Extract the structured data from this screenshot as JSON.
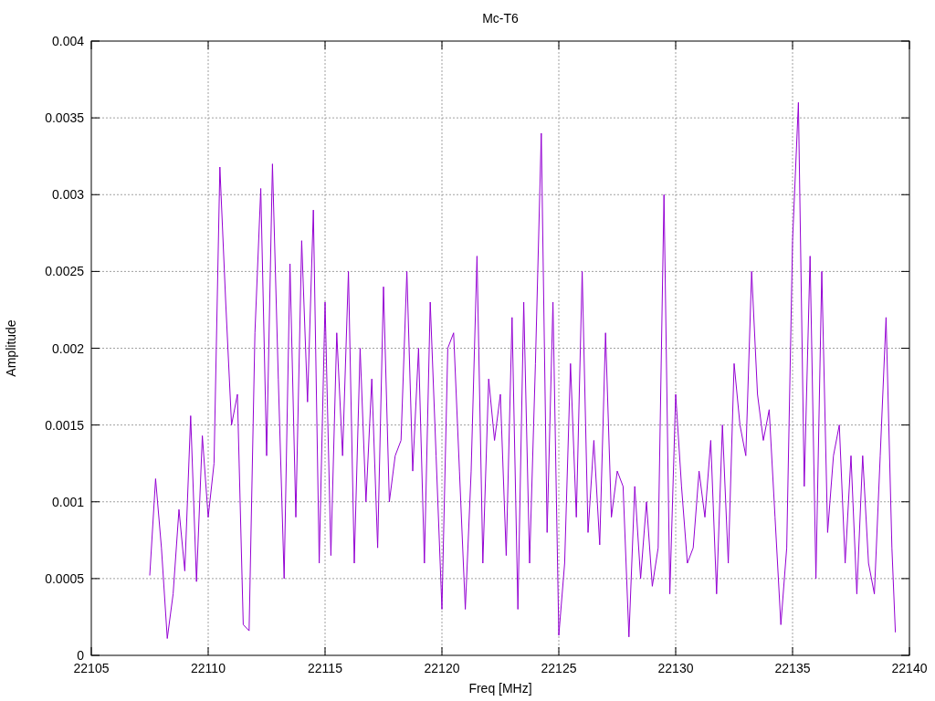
{
  "chart_data": {
    "type": "line",
    "title": "Mc-T6",
    "xlabel": "Freq [MHz]",
    "ylabel": "Amplitude",
    "grid": true,
    "xlim": [
      22105,
      22140
    ],
    "ylim": [
      0,
      0.004
    ],
    "xticks": [
      22105,
      22110,
      22115,
      22120,
      22125,
      22130,
      22135,
      22140
    ],
    "yticks": [
      0,
      0.0005,
      0.001,
      0.0015,
      0.002,
      0.0025,
      0.003,
      0.0035,
      0.004
    ],
    "x": [
      22107.5,
      22107.75,
      22108,
      22108.25,
      22108.5,
      22108.75,
      22109,
      22109.25,
      22109.5,
      22109.75,
      22110,
      22110.25,
      22110.5,
      22110.75,
      22111,
      22111.25,
      22111.5,
      22111.75,
      22112,
      22112.25,
      22112.5,
      22112.75,
      22113,
      22113.25,
      22113.5,
      22113.75,
      22114,
      22114.25,
      22114.5,
      22114.75,
      22115,
      22115.25,
      22115.5,
      22115.75,
      22116,
      22116.25,
      22116.5,
      22116.75,
      22117,
      22117.25,
      22117.5,
      22117.75,
      22118,
      22118.25,
      22118.5,
      22118.75,
      22119,
      22119.25,
      22119.5,
      22119.75,
      22120,
      22120.25,
      22120.5,
      22120.75,
      22121,
      22121.25,
      22121.5,
      22121.75,
      22122,
      22122.25,
      22122.5,
      22122.75,
      22123,
      22123.25,
      22123.5,
      22123.75,
      22124,
      22124.25,
      22124.5,
      22124.75,
      22125,
      22125.25,
      22125.5,
      22125.75,
      22126,
      22126.25,
      22126.5,
      22126.75,
      22127,
      22127.25,
      22127.5,
      22127.75,
      22128,
      22128.25,
      22128.5,
      22128.75,
      22129,
      22129.25,
      22129.5,
      22129.75,
      22130,
      22130.25,
      22130.5,
      22130.75,
      22131,
      22131.25,
      22131.5,
      22131.75,
      22132,
      22132.25,
      22132.5,
      22132.75,
      22133,
      22133.25,
      22133.5,
      22133.75,
      22134,
      22134.25,
      22134.5,
      22134.75,
      22135,
      22135.25,
      22135.5,
      22135.75,
      22136,
      22136.25,
      22136.5,
      22136.75,
      22137,
      22137.25,
      22137.5,
      22137.75,
      22138,
      22138.25,
      22138.5,
      22138.75,
      22139,
      22139.25,
      22139.4
    ],
    "series": [
      {
        "color": "#9400d3",
        "values": [
          0.00052,
          0.00115,
          0.0007,
          0.00011,
          0.0004,
          0.00095,
          0.00055,
          0.00156,
          0.00048,
          0.00143,
          0.0009,
          0.00125,
          0.00318,
          0.0023,
          0.0015,
          0.0017,
          0.0002,
          0.00016,
          0.0021,
          0.00304,
          0.0013,
          0.0032,
          0.0018,
          0.0005,
          0.00255,
          0.0009,
          0.0027,
          0.00165,
          0.0029,
          0.0006,
          0.0023,
          0.00065,
          0.0021,
          0.0013,
          0.0025,
          0.0006,
          0.002,
          0.001,
          0.0018,
          0.0007,
          0.0024,
          0.001,
          0.0013,
          0.0014,
          0.0025,
          0.0012,
          0.002,
          0.0006,
          0.0023,
          0.0013,
          0.0003,
          0.002,
          0.0021,
          0.0012,
          0.0003,
          0.0012,
          0.0026,
          0.0006,
          0.0018,
          0.0014,
          0.0017,
          0.00065,
          0.0022,
          0.0003,
          0.0023,
          0.0006,
          0.0019,
          0.0034,
          0.0008,
          0.0023,
          0.00013,
          0.0006,
          0.0019,
          0.0009,
          0.0025,
          0.0008,
          0.0014,
          0.00072,
          0.0021,
          0.0009,
          0.0012,
          0.0011,
          0.00012,
          0.0011,
          0.0005,
          0.001,
          0.00045,
          0.0007,
          0.003,
          0.0004,
          0.0017,
          0.0011,
          0.0006,
          0.0007,
          0.0012,
          0.0009,
          0.0014,
          0.0004,
          0.0015,
          0.0006,
          0.0019,
          0.0015,
          0.0013,
          0.0025,
          0.0017,
          0.0014,
          0.0016,
          0.0009,
          0.0002,
          0.0007,
          0.0027,
          0.0036,
          0.0011,
          0.0026,
          0.0005,
          0.0025,
          0.0008,
          0.0013,
          0.0015,
          0.0006,
          0.0013,
          0.0004,
          0.0013,
          0.0006,
          0.0004,
          0.0013,
          0.0022,
          0.0007,
          0.00015
        ]
      }
    ]
  }
}
